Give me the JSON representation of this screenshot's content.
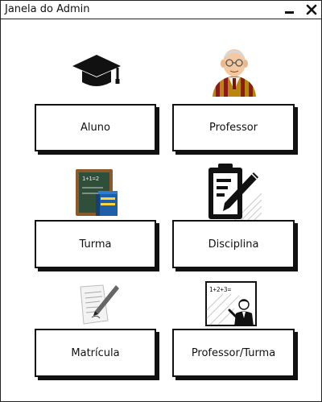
{
  "window": {
    "title": "Janela do Admin"
  },
  "buttons": {
    "aluno": "Aluno",
    "professor": "Professor",
    "turma": "Turma",
    "disciplina": "Disciplina",
    "matricula": "Matrícula",
    "professor_turma": "Professor/Turma"
  },
  "icons": {
    "aluno": "graduation-cap-icon",
    "professor": "teacher-avatar-icon",
    "turma": "chalkboard-icon",
    "disciplina": "clipboard-pen-icon",
    "matricula": "document-pen-icon",
    "professor_turma": "presenter-board-icon"
  },
  "colors": {
    "border": "#111111",
    "background": "#ffffff"
  }
}
